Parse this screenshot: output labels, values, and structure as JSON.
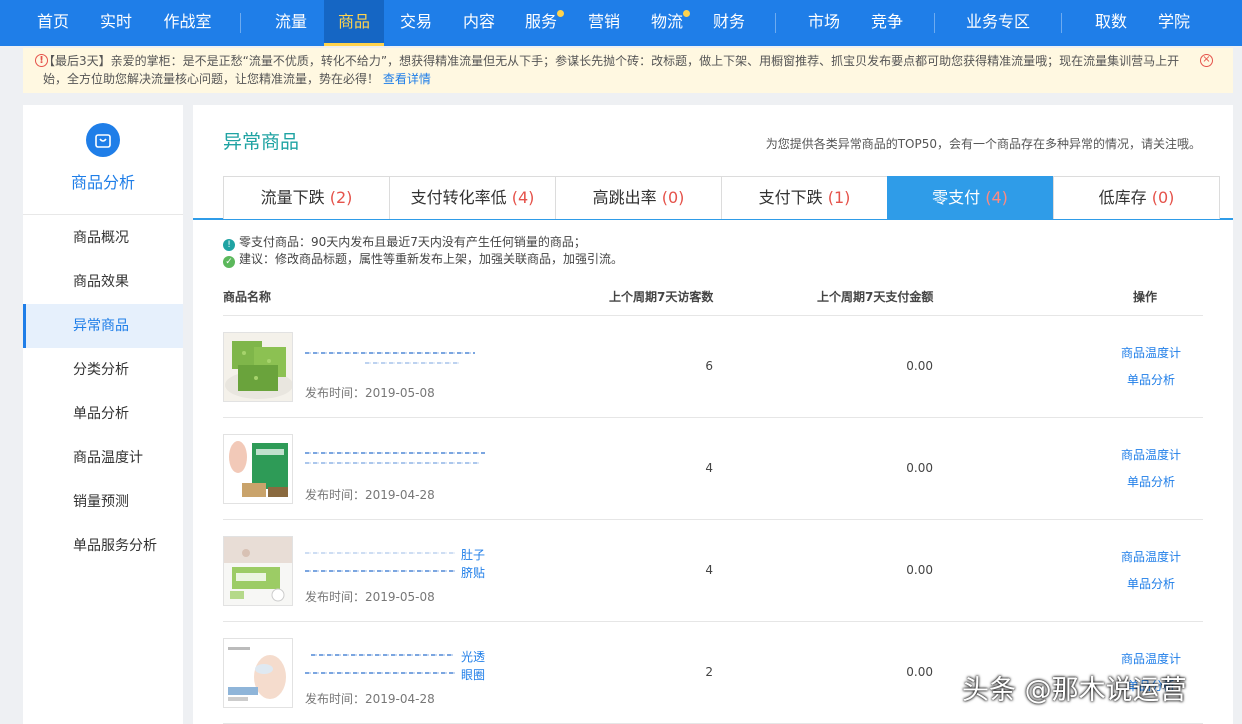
{
  "topnav": {
    "items": [
      "首页",
      "实时",
      "作战室",
      "流量",
      "商品",
      "交易",
      "内容",
      "服务",
      "营销",
      "物流",
      "财务",
      "市场",
      "竞争",
      "业务专区",
      "取数",
      "学院"
    ],
    "active": "商品",
    "colors": {
      "bg": "#1f7ee8",
      "active": "#ffd34d"
    }
  },
  "notice": {
    "text": "【最后3天】亲爱的掌柜：是不是正愁“流量不优质，转化不给力”，想获得精准流量但无从下手；参谋长先抛个砖：改标题，做上下架、用橱窗推荐、抓宝贝发布要点都可助您获得精准流量哦；现在流量集训营马上开始，全方位助您解决流量核心问题，让您精准流量，势在必得！",
    "link": "查看详情"
  },
  "sidebar": {
    "title": "商品分析",
    "items": [
      "商品概况",
      "商品效果",
      "异常商品",
      "分类分析",
      "单品分析",
      "商品温度计",
      "销量预测",
      "单品服务分析"
    ],
    "active": "异常商品"
  },
  "main": {
    "title": "异常商品",
    "desc": "为您提供各类异常商品的TOP50，会有一个商品存在多种异常的情况，请关注哦。",
    "tabs": [
      {
        "label": "流量下跌",
        "count": "(2)"
      },
      {
        "label": "支付转化率低",
        "count": "(4)"
      },
      {
        "label": "高跳出率",
        "count": "(0)"
      },
      {
        "label": "支付下跌",
        "count": "(1)"
      },
      {
        "label": "零支付",
        "count": "(4)"
      },
      {
        "label": "低库存",
        "count": "(0)"
      }
    ],
    "active_tab": "零支付",
    "tips": [
      "零支付商品：90天内发布且最近7天内没有产生任何销量的商品；",
      "建议：修改商品标题，属性等重新发布上架，加强关联商品，加强引流。"
    ],
    "headers": [
      "商品名称",
      "上个周期7天访客数",
      "上个周期7天支付金额",
      "操作"
    ],
    "rows": [
      {
        "name_visible": "",
        "time": "发布时间：2019-05-08",
        "visitors": "6",
        "amount": "0.00",
        "thumb": "green-soap"
      },
      {
        "name_visible": "",
        "time": "发布时间：2019-04-28",
        "visitors": "4",
        "amount": "0.00",
        "thumb": "foot-patch-box"
      },
      {
        "name_visible": "肚子\n脐贴",
        "time": "发布时间：2019-05-08",
        "visitors": "4",
        "amount": "0.00",
        "thumb": "navel-patch"
      },
      {
        "name_visible": "光透\n眼圈",
        "time": "发布时间：2019-04-28",
        "visitors": "2",
        "amount": "0.00",
        "thumb": "eye-mask"
      }
    ],
    "ops": [
      "商品温度计",
      "单品分析"
    ]
  },
  "watermark": "头条 @那木说运营"
}
